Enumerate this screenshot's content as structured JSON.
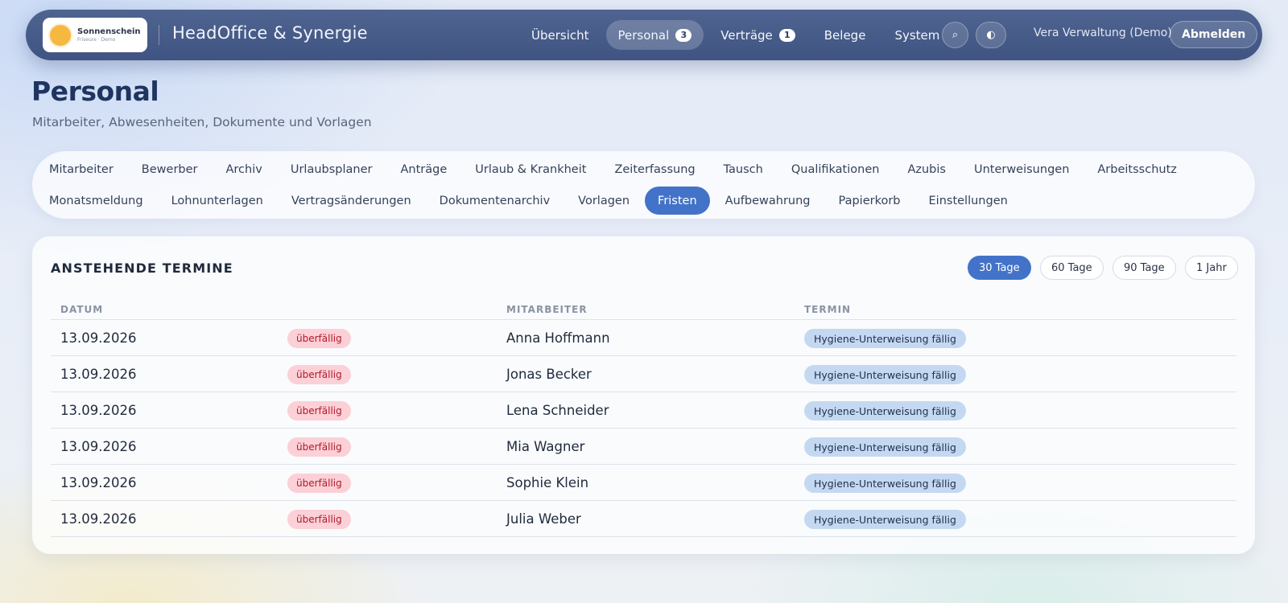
{
  "header": {
    "logo_name": "Sonnenschein",
    "logo_sub": "Friseure · Demo",
    "brand_title": "HeadOffice & Synergie",
    "nav": [
      {
        "label": "Übersicht",
        "badge": null,
        "active": false
      },
      {
        "label": "Personal",
        "badge": "3",
        "active": true
      },
      {
        "label": "Verträge",
        "badge": "1",
        "active": false
      },
      {
        "label": "Belege",
        "badge": null,
        "active": false
      },
      {
        "label": "System",
        "badge": null,
        "active": false
      }
    ],
    "search_icon": "⌕",
    "theme_icon": "◐",
    "user": "Vera Verwaltung (Demo)",
    "logout": "Abmelden"
  },
  "page": {
    "title": "Personal",
    "subtitle": "Mitarbeiter, Abwesenheiten, Dokumente und Vorlagen"
  },
  "tabs": {
    "row1": [
      "Mitarbeiter",
      "Bewerber",
      "Archiv",
      "Urlaubsplaner",
      "Anträge",
      "Urlaub & Krankheit",
      "Zeiterfassung",
      "Tausch",
      "Qualifikationen",
      "Azubis",
      "Unterweisungen",
      "Arbeitsschutz"
    ],
    "row2": [
      "Monatsmeldung",
      "Lohnunterlagen",
      "Vertragsänderungen",
      "Dokumentenarchiv",
      "Vorlagen",
      "Fristen",
      "Aufbewahrung",
      "Papierkorb",
      "Einstellungen"
    ],
    "active": "Fristen"
  },
  "card": {
    "title": "ANSTEHENDE TERMINE",
    "ranges": [
      "30 Tage",
      "60 Tage",
      "90 Tage",
      "1 Jahr"
    ],
    "active_range": "30 Tage",
    "columns": {
      "date": "DATUM",
      "employee": "MITARBEITER",
      "term": "TERMIN"
    },
    "rows": [
      {
        "date": "13.09.2026",
        "status": "überfällig",
        "employee": "Anna Hoffmann",
        "term": "Hygiene-Unterweisung fällig"
      },
      {
        "date": "13.09.2026",
        "status": "überfällig",
        "employee": "Jonas Becker",
        "term": "Hygiene-Unterweisung fällig"
      },
      {
        "date": "13.09.2026",
        "status": "überfällig",
        "employee": "Lena Schneider",
        "term": "Hygiene-Unterweisung fällig"
      },
      {
        "date": "13.09.2026",
        "status": "überfällig",
        "employee": "Mia Wagner",
        "term": "Hygiene-Unterweisung fällig"
      },
      {
        "date": "13.09.2026",
        "status": "überfällig",
        "employee": "Sophie Klein",
        "term": "Hygiene-Unterweisung fällig"
      },
      {
        "date": "13.09.2026",
        "status": "überfällig",
        "employee": "Julia Weber",
        "term": "Hygiene-Unterweisung fällig"
      }
    ]
  }
}
